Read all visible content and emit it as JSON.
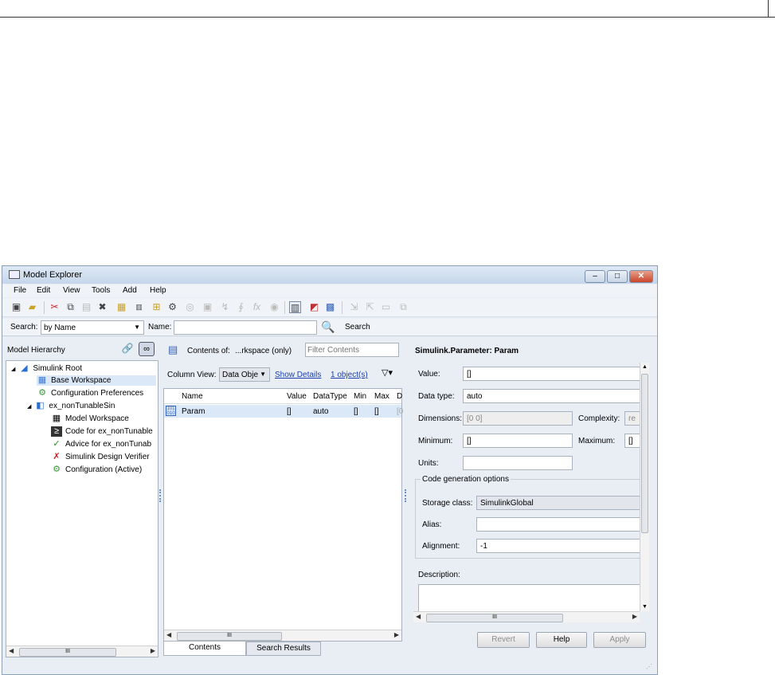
{
  "window": {
    "title": "Model Explorer",
    "minimize": "–",
    "maximize": "□",
    "close": "✕"
  },
  "menu": [
    "File",
    "Edit",
    "View",
    "Tools",
    "Add",
    "Help"
  ],
  "search": {
    "label": "Search:",
    "mode": "by Name",
    "name_label": "Name:",
    "name_value": "",
    "button": "Search"
  },
  "hierarchy": {
    "title": "Model Hierarchy",
    "items": [
      {
        "label": "Simulink Root",
        "icon": "simulink-root-icon",
        "glyph": "◢"
      },
      {
        "label": "Base Workspace",
        "icon": "workspace-icon",
        "glyph": "▦"
      },
      {
        "label": "Configuration Preferences",
        "icon": "config-gear-icon",
        "glyph": "⚙"
      },
      {
        "label": "ex_nonTunableSin",
        "icon": "model-icon",
        "glyph": "◧"
      },
      {
        "label": "Model Workspace",
        "icon": "workspace-icon",
        "glyph": "▦"
      },
      {
        "label": "Code for ex_nonTunable",
        "icon": "code-icon",
        "glyph": "≥"
      },
      {
        "label": "Advice for ex_nonTunab",
        "icon": "check-icon",
        "glyph": "✓"
      },
      {
        "label": "Simulink Design Verifier",
        "icon": "verifier-icon",
        "glyph": "✗"
      },
      {
        "label": "Configuration (Active)",
        "icon": "config-gear-icon",
        "glyph": "⚙"
      }
    ]
  },
  "contents": {
    "header_label": "Contents of:",
    "header_value": "...rkspace  (only)",
    "filter_placeholder": "Filter Contents",
    "column_view_label": "Column View:",
    "column_view_value": "Data Obje",
    "show_details": "Show Details",
    "object_count": "1 object(s)",
    "columns": [
      "Name",
      "Value",
      "DataType",
      "Min",
      "Max",
      "D"
    ],
    "rows": [
      {
        "name": "Param",
        "value": "[]",
        "datatype": "auto",
        "min": "[]",
        "max": "[]",
        "d": "[0"
      }
    ],
    "tabs": [
      "Contents",
      "Search Results"
    ]
  },
  "properties": {
    "title": "Simulink.Parameter: Param",
    "value_label": "Value:",
    "value": "[]",
    "datatype_label": "Data type:",
    "datatype": "auto",
    "dimensions_label": "Dimensions:",
    "dimensions": "[0 0]",
    "complexity_label": "Complexity:",
    "complexity": "re",
    "minimum_label": "Minimum:",
    "minimum": "[]",
    "maximum_label": "Maximum:",
    "maximum": "[]",
    "units_label": "Units:",
    "units": "",
    "codegen_title": "Code generation options",
    "storage_label": "Storage class:",
    "storage": "SimulinkGlobal",
    "alias_label": "Alias:",
    "alias": "",
    "alignment_label": "Alignment:",
    "alignment": "-1",
    "description_label": "Description:",
    "buttons": {
      "revert": "Revert",
      "help": "Help",
      "apply": "Apply"
    }
  },
  "scroll_thumb": "III"
}
